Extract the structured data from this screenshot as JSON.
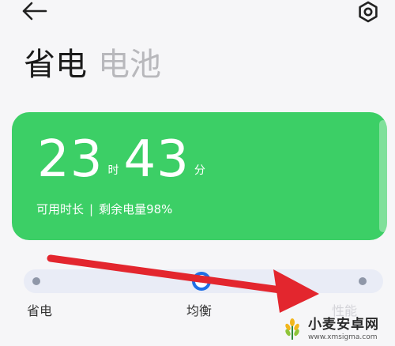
{
  "header": {
    "back_icon": "arrow-left-icon",
    "settings_icon": "gear-icon"
  },
  "tabs": [
    {
      "label": "省电",
      "active": true
    },
    {
      "label": "电池",
      "active": false
    }
  ],
  "battery_card": {
    "hours": "23",
    "hours_unit": "时",
    "minutes": "43",
    "minutes_unit": "分",
    "available_label": "可用时长",
    "separator": "|",
    "remaining_label": "剩余电量98%",
    "remaining_percent": 98,
    "color": "#3ccf66"
  },
  "mode_selector": {
    "selected_index": 1,
    "options": [
      {
        "label": "省电"
      },
      {
        "label": "均衡"
      },
      {
        "label": "性能"
      }
    ]
  },
  "watermark": {
    "title": "小麦安卓网",
    "url": "www.xmsigma.com",
    "icon": "wheat-logo-icon"
  },
  "colors": {
    "accent": "#1f6fe6",
    "card_green": "#3ccf66",
    "arrow_red": "#e3262e"
  }
}
